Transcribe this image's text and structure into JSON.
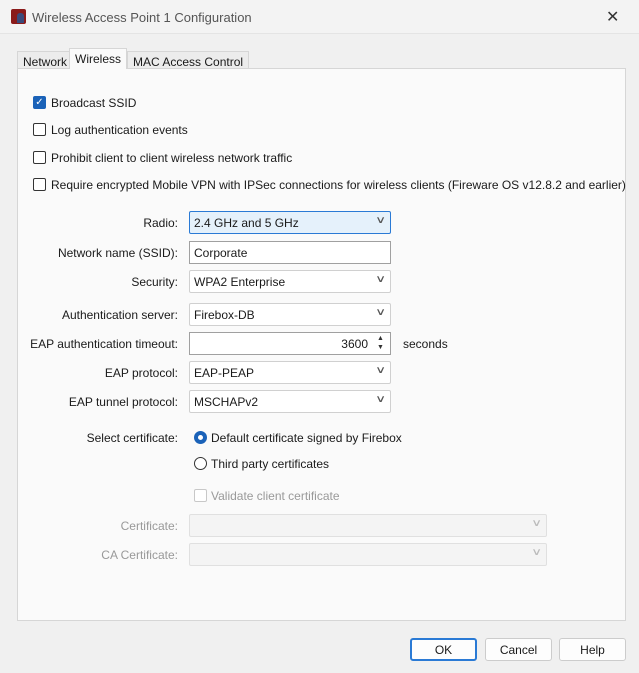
{
  "window": {
    "title": "Wireless Access Point 1 Configuration",
    "close": "✕"
  },
  "tabs": [
    "Network",
    "Wireless",
    "MAC Access Control"
  ],
  "checkboxes": [
    {
      "label": "Broadcast SSID",
      "checked": true
    },
    {
      "label": "Log authentication events",
      "checked": false
    },
    {
      "label": "Prohibit client to client wireless network traffic",
      "checked": false
    },
    {
      "label": "Require encrypted Mobile VPN with IPSec connections for wireless clients (Fireware OS v12.8.2 and earlier)",
      "checked": false
    }
  ],
  "form": {
    "radio": {
      "label": "Radio:",
      "value": "2.4 GHz and 5 GHz"
    },
    "ssid": {
      "label": "Network name (SSID):",
      "value": "Corporate"
    },
    "security": {
      "label": "Security:",
      "value": "WPA2 Enterprise"
    },
    "auth_server": {
      "label": "Authentication server:",
      "value": "Firebox-DB"
    },
    "eap_timeout": {
      "label": "EAP authentication timeout:",
      "value": "3600",
      "unit": "seconds"
    },
    "eap_protocol": {
      "label": "EAP protocol:",
      "value": "EAP-PEAP"
    },
    "eap_tunnel": {
      "label": "EAP tunnel protocol:",
      "value": "MSCHAPv2"
    },
    "select_cert": {
      "label": "Select certificate:",
      "options": [
        "Default certificate signed by Firebox",
        "Third party certificates"
      ],
      "selected": 0
    },
    "validate_client": {
      "label": "Validate client certificate",
      "checked": false
    },
    "certificate": {
      "label": "Certificate:",
      "value": ""
    },
    "ca_certificate": {
      "label": "CA Certificate:",
      "value": ""
    }
  },
  "buttons": {
    "ok": "OK",
    "cancel": "Cancel",
    "help": "Help"
  }
}
